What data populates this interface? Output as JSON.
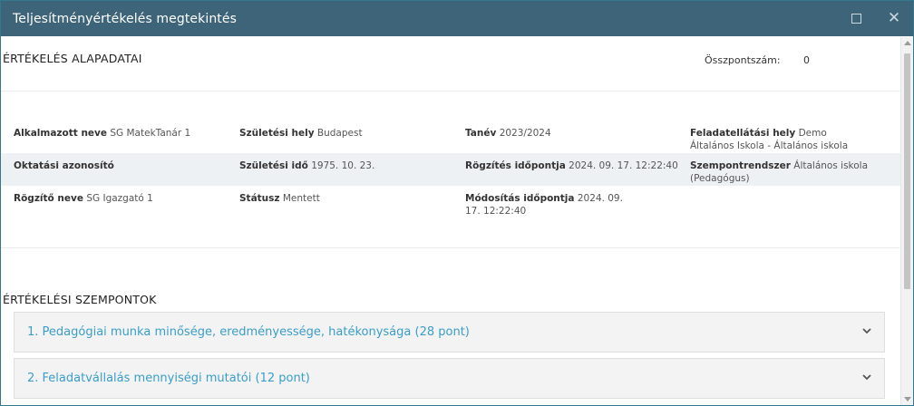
{
  "window": {
    "title": "Teljesítményértékelés megtekintés"
  },
  "basics": {
    "heading": "ÉRTÉKELÉS ALAPADATAI",
    "total_label": "Összpontszám:",
    "total_value": "0"
  },
  "info": {
    "rows": [
      [
        {
          "label": "Alkalmazott neve",
          "value": "SG MatekTanár 1"
        },
        {
          "label": "Születési hely",
          "value": "Budapest"
        },
        {
          "label": "Tanév",
          "value": "2023/2024"
        },
        {
          "label": "Feladatellátási hely",
          "value": "Demo Általános Iskola - Általános iskola"
        }
      ],
      [
        {
          "label": "Oktatási azonosító",
          "value": ""
        },
        {
          "label": "Születési idő",
          "value": "1975. 10. 23."
        },
        {
          "label": "Rögzítés időpontja",
          "value": "2024. 09. 17. 12:22:40"
        },
        {
          "label": "Szempontrendszer",
          "value": "Általános iskola (Pedagógus)"
        }
      ],
      [
        {
          "label": "Rögzítő neve",
          "value": "SG Igazgató 1"
        },
        {
          "label": "Státusz",
          "value": "Mentett"
        },
        {
          "label": "Módosítás időpontja",
          "value": "2024. 09. 17. 12:22:40"
        },
        {
          "label": "",
          "value": ""
        }
      ]
    ]
  },
  "criteria": {
    "heading": "ÉRTÉKELÉSI SZEMPONTOK",
    "items": [
      {
        "label": "1. Pedagógiai munka minősége, eredményessége, hatékonysága (28 pont)"
      },
      {
        "label": "2. Feladatvállalás mennyiségi mutatói (12 pont)"
      }
    ]
  },
  "icons": {
    "maximize": "maximize-icon",
    "close": "close-icon",
    "expand": "chevron-down-icon"
  },
  "colors": {
    "titlebar": "#3d6478",
    "accent": "#3a9ec9"
  }
}
